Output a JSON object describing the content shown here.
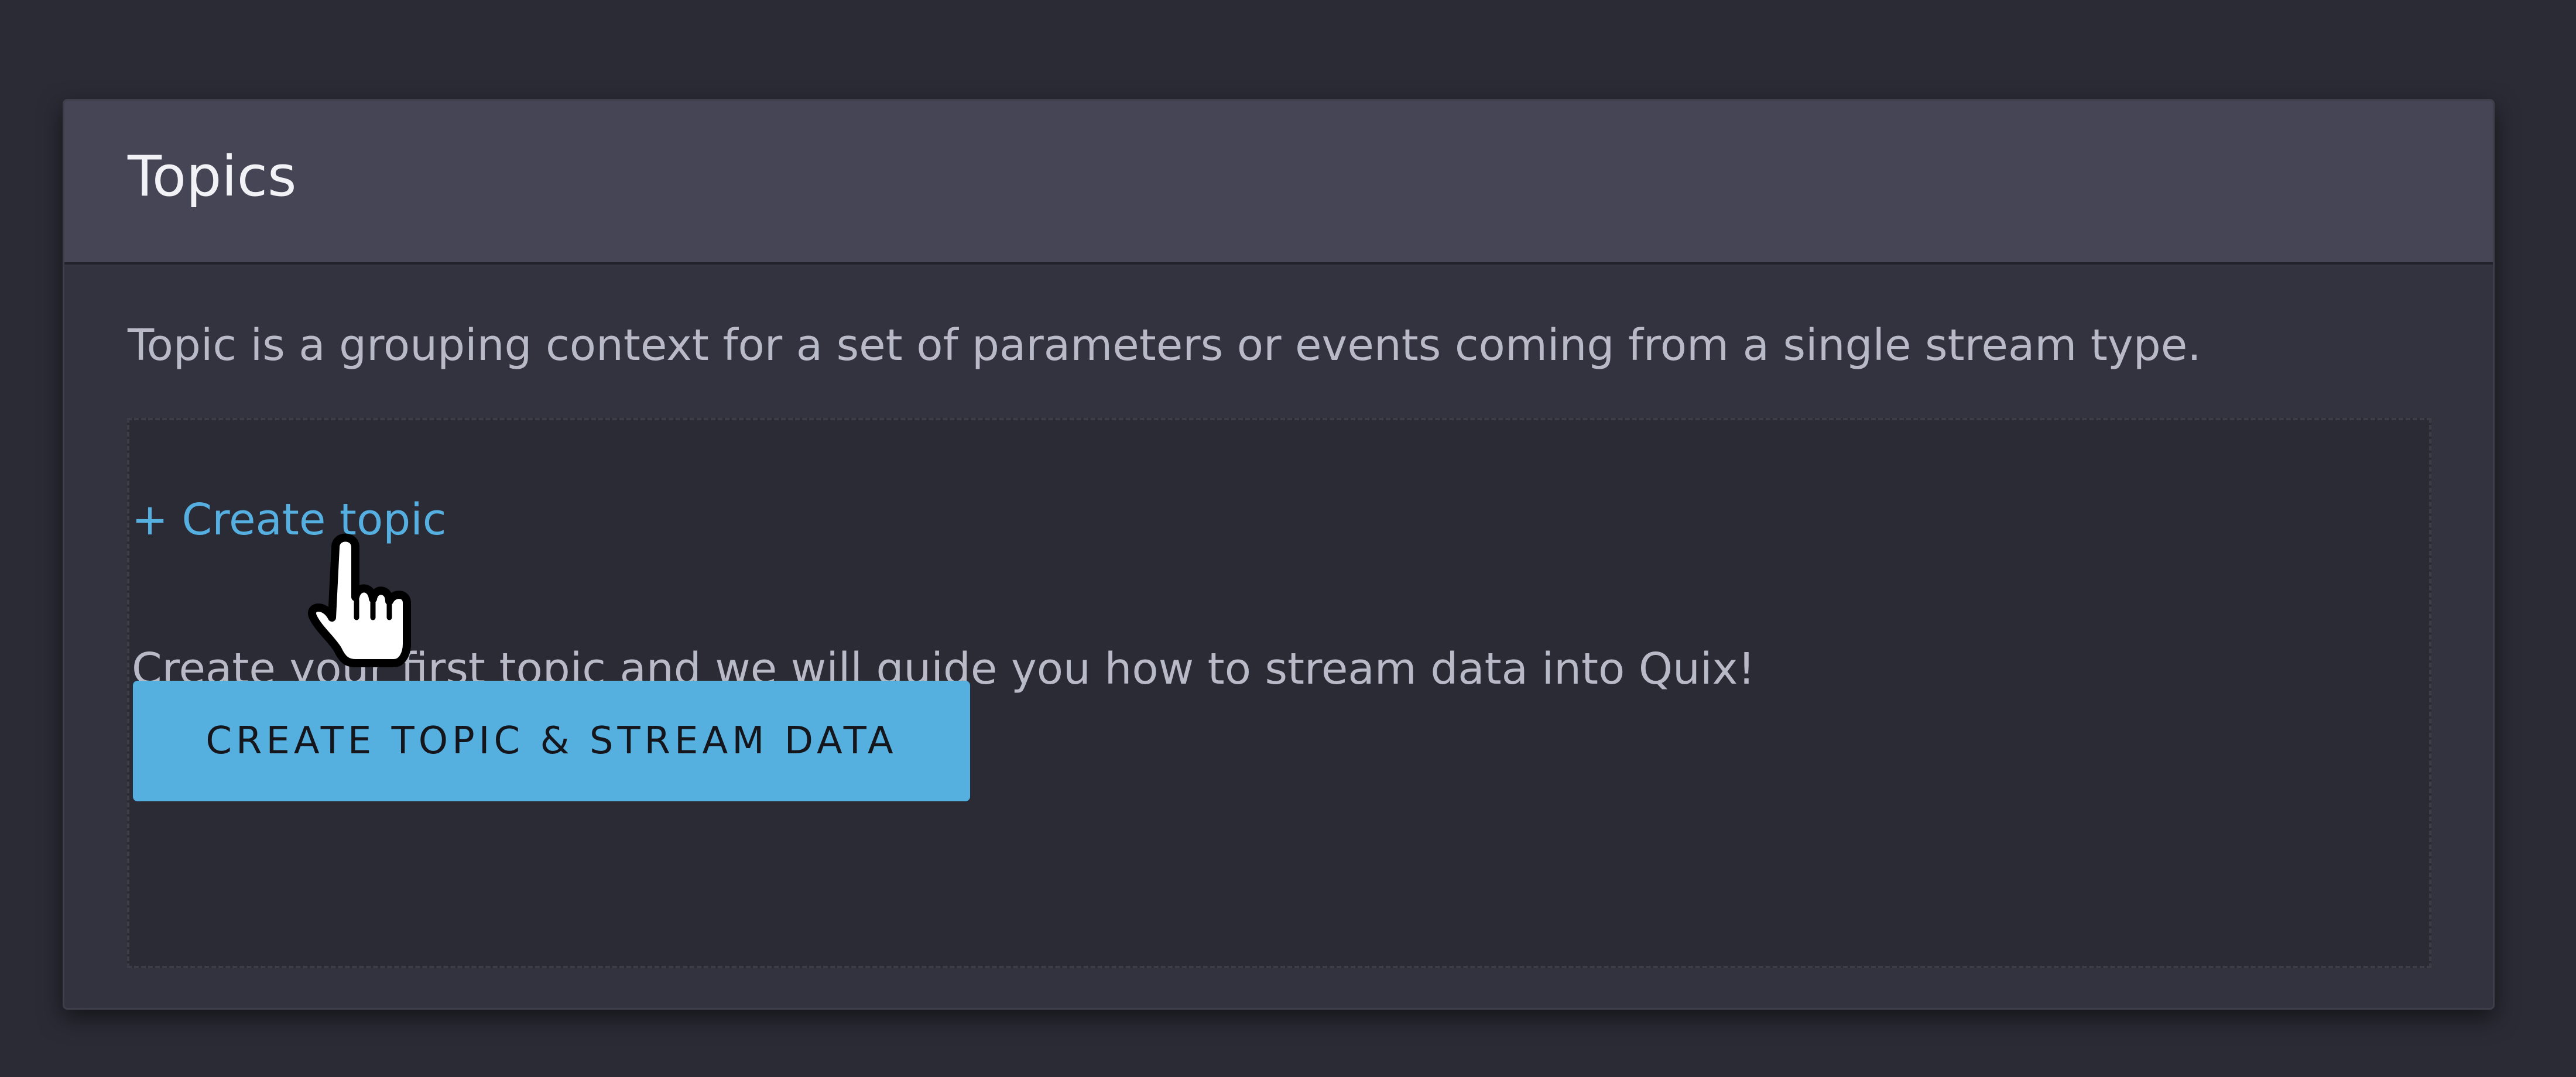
{
  "topics_card": {
    "title": "Topics",
    "description": "Topic is a grouping context for a set of parameters or events coming from a single stream type."
  },
  "empty_state": {
    "create_link": "+ Create topic",
    "message": "Create your first topic and we will guide you how to stream data into Quix!",
    "primary_button": "CREATE TOPIC & STREAM DATA"
  },
  "colors": {
    "page_background": "#2b2b35",
    "card_background": "#33333f",
    "header_background": "#454555",
    "accent": "#55afdf",
    "muted_text": "#b9bac8"
  },
  "cursor": {
    "icon": "hand-pointer-icon"
  }
}
